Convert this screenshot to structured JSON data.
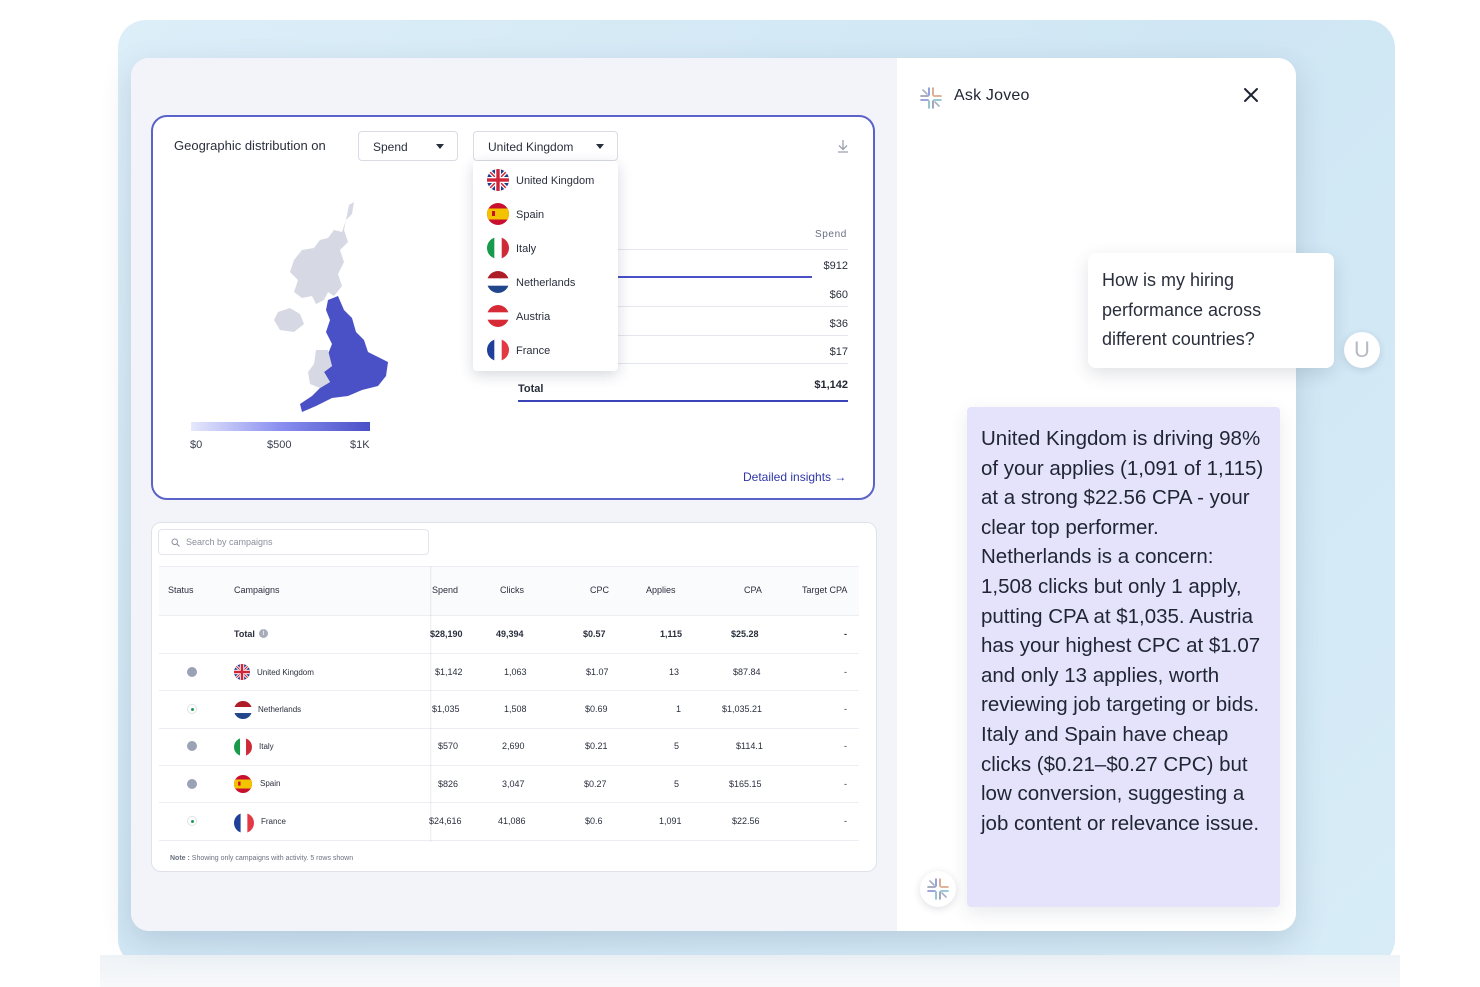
{
  "panel": {
    "title": "Ask Joveo"
  },
  "geo": {
    "label": "Geographic distribution on",
    "metric_select": "Spend",
    "country_select": "United Kingdom",
    "dropdown_options": [
      "United Kingdom",
      "Spain",
      "Italy",
      "Netherlands",
      "Austria",
      "France"
    ],
    "legend": [
      "$0",
      "$500",
      "$1K"
    ],
    "spend_header": "Spend",
    "spend_values": [
      "$912",
      "$60",
      "$36",
      "$17"
    ],
    "total_label": "Total",
    "total_value": "$1,142",
    "detailed_link": "Detailed insights →"
  },
  "table": {
    "search_placeholder": "Search by campaigns",
    "columns": [
      "Status",
      "Campaigns",
      "Spend",
      "Clicks",
      "CPC",
      "Applies",
      "CPA",
      "Target CPA"
    ],
    "total_row": {
      "label": "Total",
      "spend": "$28,190",
      "clicks": "49,394",
      "cpc": "$0.57",
      "applies": "1,115",
      "cpa": "$25.28",
      "target": "-"
    },
    "rows": [
      {
        "status": "paused",
        "campaign": "United Kingdom",
        "spend": "$1,142",
        "clicks": "1,063",
        "cpc": "$1.07",
        "applies": "13",
        "cpa": "$87.84",
        "target": "-"
      },
      {
        "status": "active",
        "campaign": "Netherlands",
        "spend": "$1,035",
        "clicks": "1,508",
        "cpc": "$0.69",
        "applies": "1",
        "cpa": "$1,035.21",
        "target": "-"
      },
      {
        "status": "paused",
        "campaign": "Italy",
        "spend": "$570",
        "clicks": "2,690",
        "cpc": "$0.21",
        "applies": "5",
        "cpa": "$114.1",
        "target": "-"
      },
      {
        "status": "paused",
        "campaign": "Spain",
        "spend": "$826",
        "clicks": "3,047",
        "cpc": "$0.27",
        "applies": "5",
        "cpa": "$165.15",
        "target": "-"
      },
      {
        "status": "active",
        "campaign": "France",
        "spend": "$24,616",
        "clicks": "41,086",
        "cpc": "$0.6",
        "applies": "1,091",
        "cpa": "$22.56",
        "target": "-"
      }
    ],
    "note_bold": "Note :",
    "note_text": "Showing only campaigns with activity. 5 rows shown"
  },
  "chat": {
    "question": "How is my hiring performance across different countries?",
    "user_avatar": "U",
    "answer": "United Kingdom is driving 98% of your applies (1,091 of 1,115) at a strong $22.56 CPA - your clear top performer. Netherlands is a concern: 1,508 clicks but only 1 apply, putting CPA at $1,035. Austria has your highest CPC at $1.07 and only 13 applies, worth reviewing job targeting or bids. Italy and Spain have cheap clicks ($0.21–$0.27 CPC) but low conversion, suggesting a job content or relevance issue."
  },
  "colors": {
    "accent": "#4a50c6",
    "card_border": "#5b62c9",
    "answer_bg": "#e4e3fb",
    "active_dot": "#1e9a55",
    "paused_dot": "#9aa3b5"
  }
}
